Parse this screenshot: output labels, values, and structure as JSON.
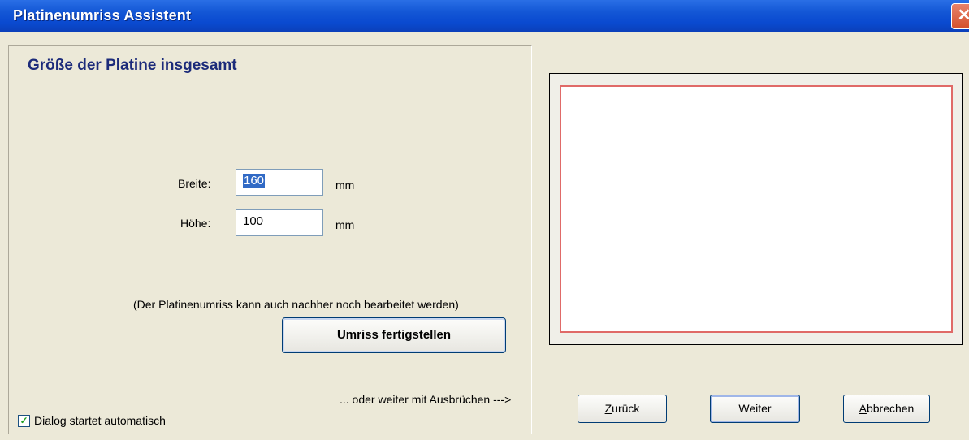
{
  "window": {
    "title": "Platinenumriss Assistent",
    "close_glyph": "✕"
  },
  "section": {
    "heading": "Größe der Platine insgesamt"
  },
  "size": {
    "width_label": "Breite:",
    "width_value": "160",
    "width_unit": "mm",
    "height_label": "Höhe:",
    "height_value": "100",
    "height_unit": "mm"
  },
  "note": "(Der Platinenumriss kann auch nachher noch bearbeitet werden)",
  "finish_button": "Umriss fertigstellen",
  "continue_hint": "... oder weiter mit Ausbrüchen --->",
  "autostart": {
    "label": "Dialog startet automatisch",
    "checked": true
  },
  "buttons": {
    "back_mnemonic": "Z",
    "back_rest": "urück",
    "next": "Weiter",
    "cancel_mnemonic": "A",
    "cancel_rest": "bbrechen"
  },
  "colors": {
    "title_bar": "#0b4ad0",
    "board_outline": "#e06a68",
    "heading": "#1c2b7a"
  }
}
